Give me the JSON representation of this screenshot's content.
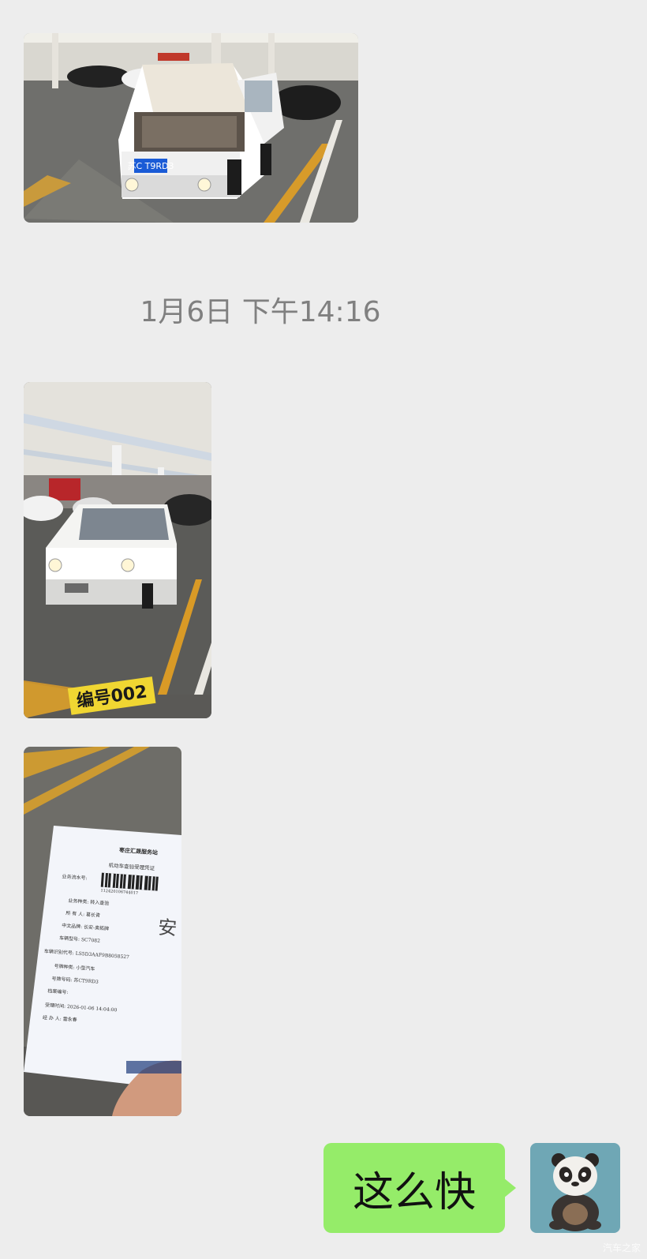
{
  "chat": {
    "timestamp": "1月6日 下午14:16",
    "message_text": "这么快"
  },
  "photos": {
    "car_engine": {
      "plate_text": "苏C T9RD3"
    },
    "car_lot": {
      "spot_label": "编号002"
    },
    "receipt": {
      "title": "枣庄汇晟服务站",
      "subtitle": "机动车查验受理凭证",
      "rows": [
        "业务流水号:",
        "业务种类:  转入查验",
        "所 有 人:  葛长青",
        "中文品牌:  长安-奥拓牌",
        "车辆型号:  SC7082",
        "车辆识别代号: LS5D3AAF9B8058527",
        "号牌种类:  小型汽车",
        "号牌号码:  苏CT9RD3",
        "档案编号:",
        "受理时间:  2026-01-06 14:04:00",
        "经 办 人:  雷永春"
      ],
      "barcode_number": "112420106744017",
      "handwritten_mark": "安"
    }
  },
  "watermark": "汽车之家",
  "colors": {
    "background": "#ededed",
    "bubble": "#95ec69",
    "timestamp": "#808080"
  }
}
